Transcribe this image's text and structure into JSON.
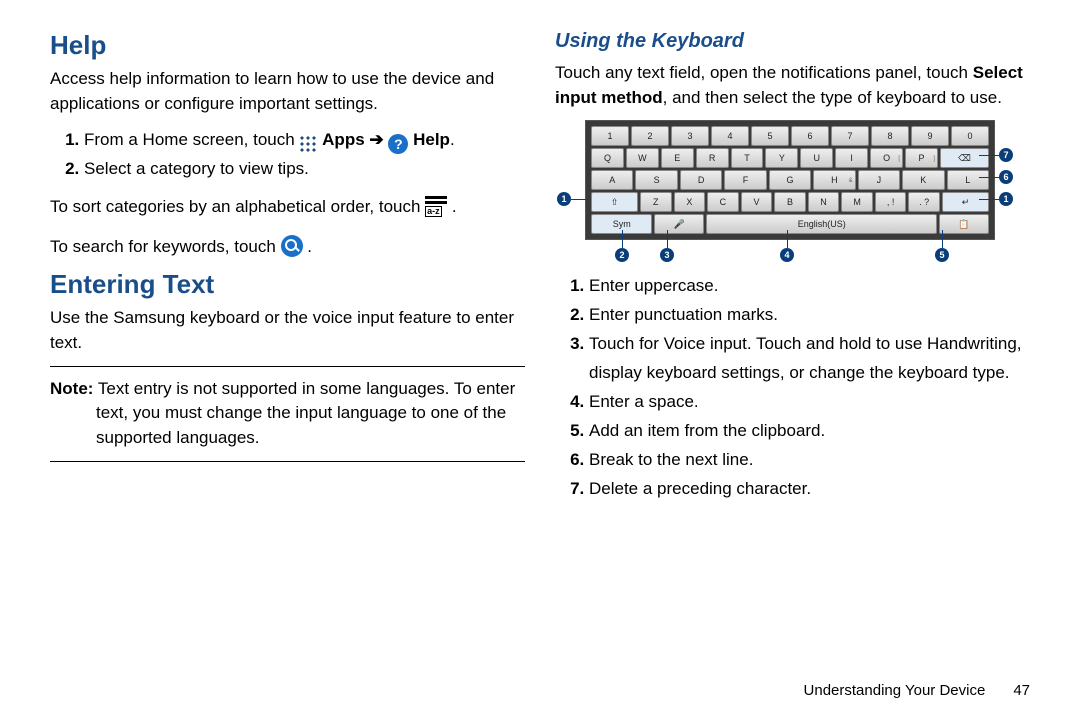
{
  "left": {
    "h1a": "Help",
    "p1": "Access help information to learn how to use the device and applications or configure important settings.",
    "li1_pre": "From a Home screen, touch ",
    "li1_apps": "Apps",
    "li1_arrow": " ➔ ",
    "li1_help": "Help",
    "li1_end": ".",
    "li2": "Select a category to view tips.",
    "p2_pre": "To sort categories by an alphabetical order, touch ",
    "p2_end": " .",
    "p3_pre": "To search for keywords, touch ",
    "p3_end": " .",
    "h1b": "Entering Text",
    "p4": "Use the Samsung keyboard or the voice input feature to enter text.",
    "note_label": "Note:",
    "note_body": " Text entry is not supported in some languages. To enter text, you must change the input language to one of the supported languages."
  },
  "right": {
    "h2": "Using the Keyboard",
    "p1a": "Touch any text field, open the notifications panel, touch ",
    "p1b": "Select input method",
    "p1c": ", and then select the type of keyboard to use.",
    "li1": "Enter uppercase.",
    "li2": "Enter punctuation marks.",
    "li3": "Touch for Voice input. Touch and hold to use Handwriting, display keyboard settings, or change the keyboard type.",
    "li4": "Enter a space.",
    "li5": "Add an item from the clipboard.",
    "li6": "Break to the next line.",
    "li7": "Delete a preceding character."
  },
  "keyboard": {
    "row1": [
      "1",
      "2",
      "3",
      "4",
      "5",
      "6",
      "7",
      "8",
      "9",
      "0"
    ],
    "row2": [
      "Q",
      "W",
      "E",
      "R",
      "T",
      "Y",
      "U",
      "I",
      "O",
      "P"
    ],
    "row2sub": [
      "",
      "",
      "",
      "",
      "",
      "",
      "",
      "",
      "[",
      "]"
    ],
    "row3": [
      "A",
      "S",
      "D",
      "F",
      "G",
      "H",
      "J",
      "K",
      "L"
    ],
    "row3sub": [
      "",
      "",
      "",
      "",
      "",
      "&",
      "",
      "",
      ""
    ],
    "row4_shift": "⇧",
    "row4": [
      "Z",
      "X",
      "C",
      "V",
      "B",
      "N",
      "M"
    ],
    "row4_punc1": ", !",
    "row4_punc2": ". ?",
    "row4_enter": "↵",
    "row5_sym": "Sym",
    "row5_mic": "🎤",
    "row5_lang": "English(US)",
    "row5_clip": "📋",
    "bsp": "⌫"
  },
  "footer": {
    "section": "Understanding Your Device",
    "page": "47"
  }
}
